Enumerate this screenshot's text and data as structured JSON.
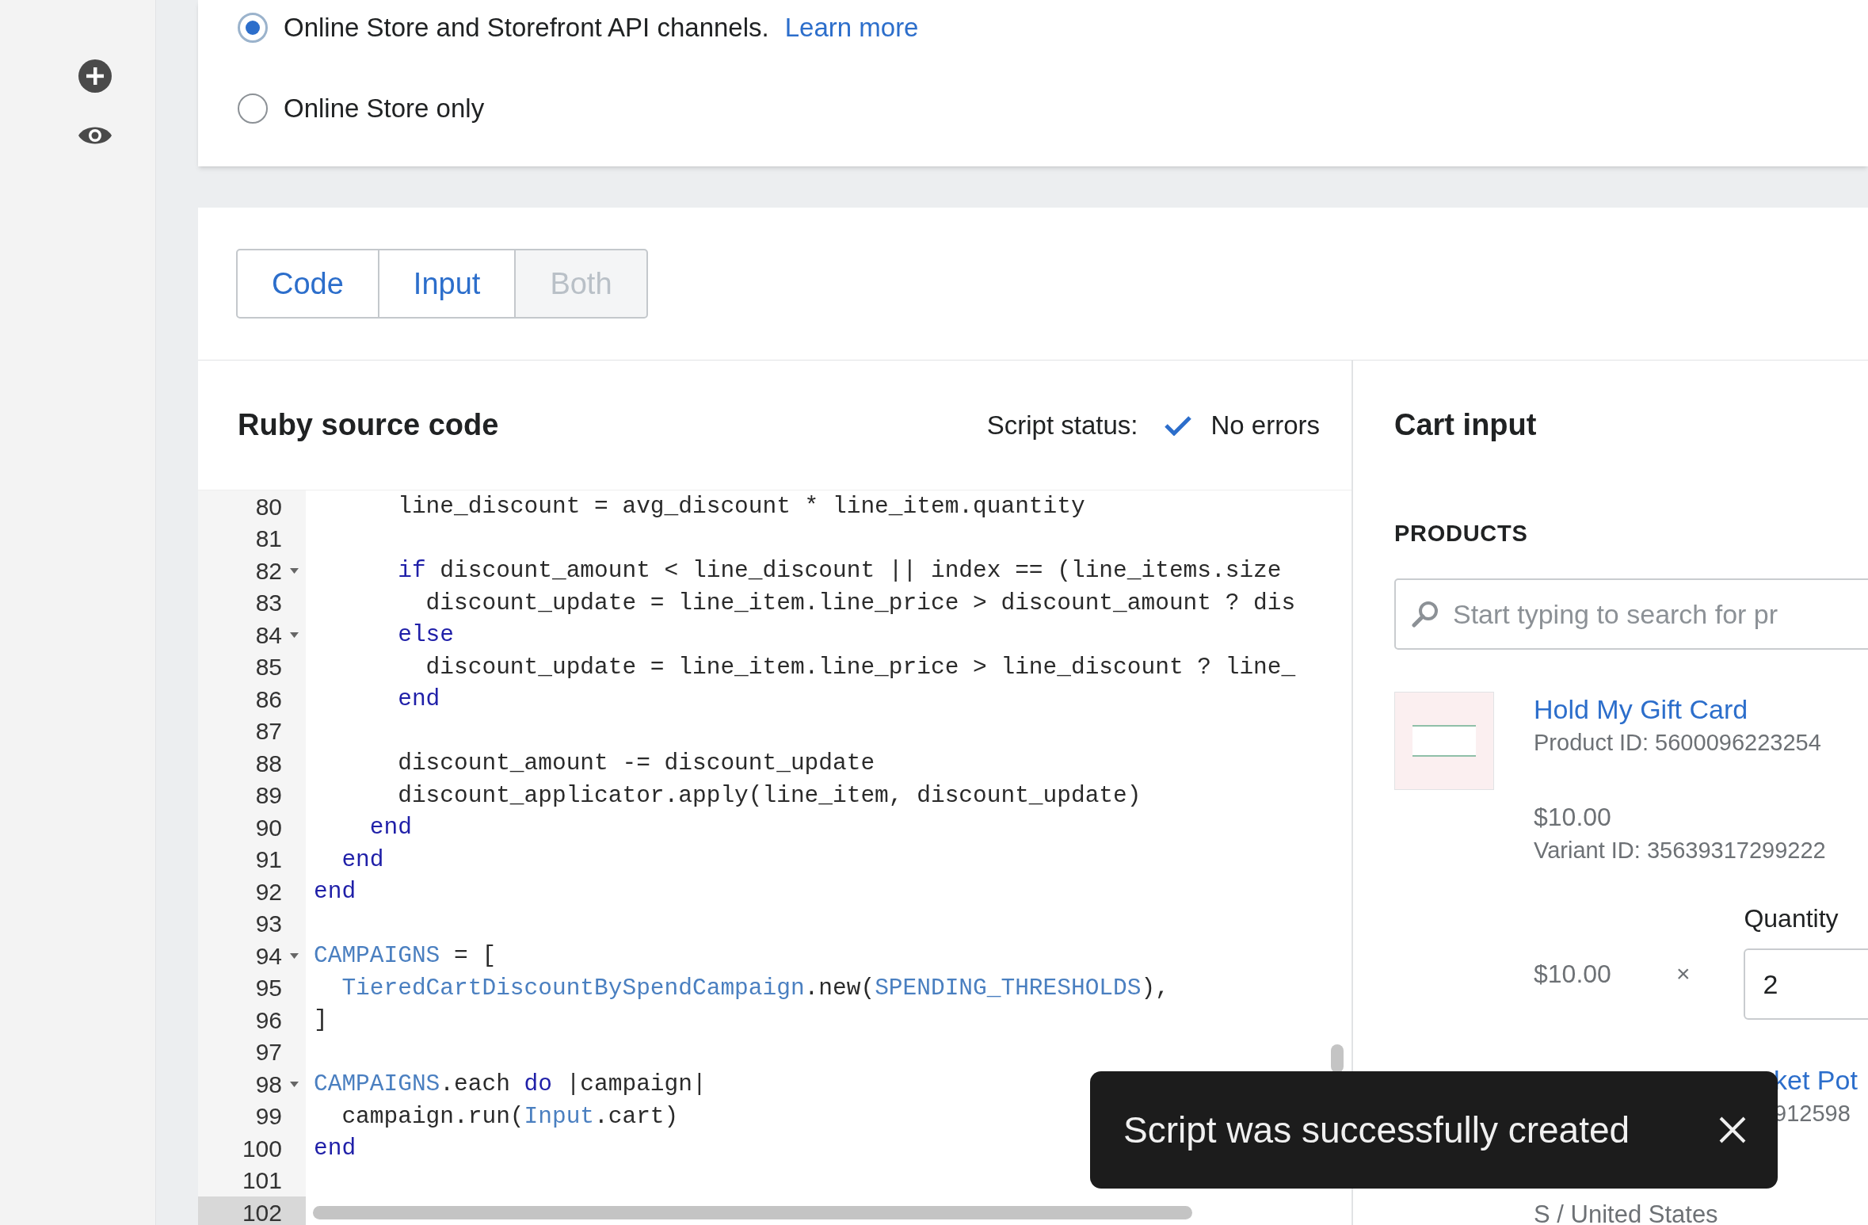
{
  "sales_channels": {
    "options": [
      {
        "label": "Online Store and Storefront API channels.",
        "link": "Learn more",
        "selected": true
      },
      {
        "label": "Online Store only",
        "selected": false
      }
    ]
  },
  "view_tabs": [
    {
      "label": "Code",
      "selected": false
    },
    {
      "label": "Input",
      "selected": false
    },
    {
      "label": "Both",
      "selected": true
    }
  ],
  "editor": {
    "title": "Ruby source code",
    "status_label": "Script status:",
    "status": "No errors",
    "lines": [
      {
        "number": "80",
        "foldable": false,
        "active": false,
        "tokens": [
          {
            "kind": "text",
            "text": "      line_discount = avg_discount * line_item.quantity"
          }
        ]
      },
      {
        "number": "81",
        "foldable": false,
        "active": false
      },
      {
        "number": "82",
        "foldable": true,
        "active": false,
        "tokens": [
          {
            "kind": "keyword",
            "text": "      if"
          },
          {
            "kind": "text",
            "text": " discount_amount < line_discount || index == (line_items.size"
          }
        ]
      },
      {
        "number": "83",
        "foldable": false,
        "active": false,
        "tokens": [
          {
            "kind": "text",
            "text": "        discount_update = line_item.line_price > discount_amount ? dis"
          }
        ]
      },
      {
        "number": "84",
        "foldable": true,
        "active": false,
        "tokens": [
          {
            "kind": "keyword",
            "text": "      else"
          }
        ]
      },
      {
        "number": "85",
        "foldable": false,
        "active": false,
        "tokens": [
          {
            "kind": "text",
            "text": "        discount_update = line_item.line_price > line_discount ? line_"
          }
        ]
      },
      {
        "number": "86",
        "foldable": false,
        "active": false,
        "tokens": [
          {
            "kind": "keyword",
            "text": "      end"
          }
        ]
      },
      {
        "number": "87",
        "foldable": false,
        "active": false
      },
      {
        "number": "88",
        "foldable": false,
        "active": false,
        "tokens": [
          {
            "kind": "text",
            "text": "      discount_amount -= discount_update"
          }
        ]
      },
      {
        "number": "89",
        "foldable": false,
        "active": false,
        "tokens": [
          {
            "kind": "text",
            "text": "      discount_applicator.apply(line_item, discount_update)"
          }
        ]
      },
      {
        "number": "90",
        "foldable": false,
        "active": false,
        "tokens": [
          {
            "kind": "keyword",
            "text": "    end"
          }
        ]
      },
      {
        "number": "91",
        "foldable": false,
        "active": false,
        "tokens": [
          {
            "kind": "keyword",
            "text": "  end"
          }
        ]
      },
      {
        "number": "92",
        "foldable": false,
        "active": false,
        "tokens": [
          {
            "kind": "keyword",
            "text": "end"
          }
        ]
      },
      {
        "number": "93",
        "foldable": false,
        "active": false
      },
      {
        "number": "94",
        "foldable": true,
        "active": false,
        "tokens": [
          {
            "kind": "constant",
            "text": "CAMPAIGNS"
          },
          {
            "kind": "text",
            "text": " = ["
          }
        ]
      },
      {
        "number": "95",
        "foldable": false,
        "active": false,
        "tokens": [
          {
            "kind": "constant",
            "text": "  TieredCartDiscountBySpendCampaign"
          },
          {
            "kind": "text",
            "text": ".new("
          },
          {
            "kind": "constant",
            "text": "SPENDING_THRESHOLDS"
          },
          {
            "kind": "text",
            "text": "),"
          }
        ]
      },
      {
        "number": "96",
        "foldable": false,
        "active": false,
        "tokens": [
          {
            "kind": "text",
            "text": "]"
          }
        ]
      },
      {
        "number": "97",
        "foldable": false,
        "active": false
      },
      {
        "number": "98",
        "foldable": true,
        "active": false,
        "tokens": [
          {
            "kind": "constant",
            "text": "CAMPAIGNS"
          },
          {
            "kind": "text",
            "text": ".each "
          },
          {
            "kind": "keyword",
            "text": "do"
          },
          {
            "kind": "text",
            "text": " |campaign|"
          }
        ]
      },
      {
        "number": "99",
        "foldable": false,
        "active": false,
        "tokens": [
          {
            "kind": "text",
            "text": "  campaign.run("
          },
          {
            "kind": "constant",
            "text": "Input"
          },
          {
            "kind": "text",
            "text": ".cart)"
          }
        ]
      },
      {
        "number": "100",
        "foldable": false,
        "active": false,
        "tokens": [
          {
            "kind": "keyword",
            "text": "end"
          }
        ]
      },
      {
        "number": "101",
        "foldable": false,
        "active": false
      },
      {
        "number": "102",
        "foldable": false,
        "active": true
      }
    ]
  },
  "cart_input": {
    "title": "Cart input",
    "section": "PRODUCTS",
    "search": {
      "placeholder": "Start typing to search for pr"
    },
    "products": [
      {
        "kind": "full",
        "name": "Hold My Gift Card",
        "product_id": "Product ID: 5600096223254",
        "price": "$10.00",
        "variant_id": "Variant ID: 35639317299222",
        "unit_price": "$10.00",
        "times": "×",
        "quantity_label": "Quantity",
        "quantity": "2"
      },
      {
        "kind": "covered",
        "name": "ket Pot",
        "product_id": "912598",
        "variant_title": "S / United States"
      }
    ]
  },
  "toast": {
    "message": "Script was successfully created"
  }
}
